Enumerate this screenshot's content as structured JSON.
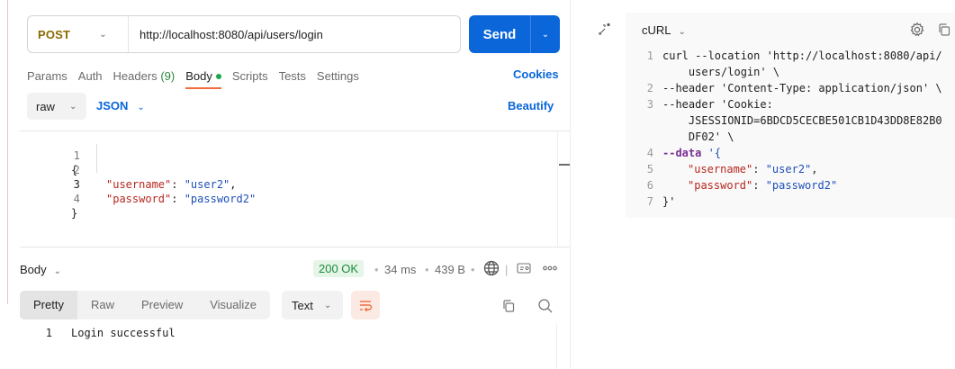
{
  "request": {
    "method": "POST",
    "url": "http://localhost:8080/api/users/login",
    "send_label": "Send"
  },
  "tabs": [
    {
      "label": "Params"
    },
    {
      "label": "Auth"
    },
    {
      "label": "Headers",
      "count": "(9)"
    },
    {
      "label": "Body",
      "active": true
    },
    {
      "label": "Scripts"
    },
    {
      "label": "Tests"
    },
    {
      "label": "Settings"
    }
  ],
  "cookies_label": "Cookies",
  "body": {
    "mode": "raw",
    "language": "JSON",
    "beautify_label": "Beautify",
    "lines": [
      {
        "n": "1",
        "text": "{"
      },
      {
        "n": "2",
        "key": "\"username\"",
        "value": "\"user2\""
      },
      {
        "n": "3",
        "key": "\"password\"",
        "value": "\"password2\""
      },
      {
        "n": "4",
        "text": "}"
      }
    ]
  },
  "response": {
    "section_label": "Body",
    "status": "200 OK",
    "time": "34 ms",
    "size": "439 B",
    "view_tabs": [
      "Pretty",
      "Raw",
      "Preview",
      "Visualize"
    ],
    "active_view": "Pretty",
    "format": "Text",
    "line_number": "1",
    "content": "Login successful"
  },
  "snippet": {
    "language": "cURL",
    "lines": [
      {
        "n": "1",
        "text": "curl --location 'http://localhost:8080/api/"
      },
      {
        "n": "",
        "text": "    users/login' \\"
      },
      {
        "n": "2",
        "text": "--header 'Content-Type: application/json' \\"
      },
      {
        "n": "3",
        "text": "--header 'Cookie:"
      },
      {
        "n": "",
        "text": "    JSESSIONID=6BDCD5CECBE501CB1D43DD8E82B0"
      },
      {
        "n": "",
        "text": "    DF02' \\"
      },
      {
        "n": "4",
        "kw": "--data",
        "rest": " '{"
      },
      {
        "n": "5",
        "key": "\"username\"",
        "value": "\"user2\""
      },
      {
        "n": "6",
        "key": "\"password\"",
        "value": "\"password2\""
      },
      {
        "n": "7",
        "text": "}'"
      }
    ]
  },
  "colors": {
    "send": "#0a66d9",
    "method": "#8a6a00",
    "status_ok": "#1e8b3d",
    "json_key": "#b8271f",
    "json_string": "#1f4fb8",
    "active_tab_underline": "#f36c3d"
  },
  "icons": [
    "chevron-down-icon",
    "globe-icon",
    "certificate-icon",
    "more-icon",
    "copy-icon",
    "search-icon",
    "wrap-lines-icon",
    "code-snippet-icon",
    "gear-icon"
  ]
}
